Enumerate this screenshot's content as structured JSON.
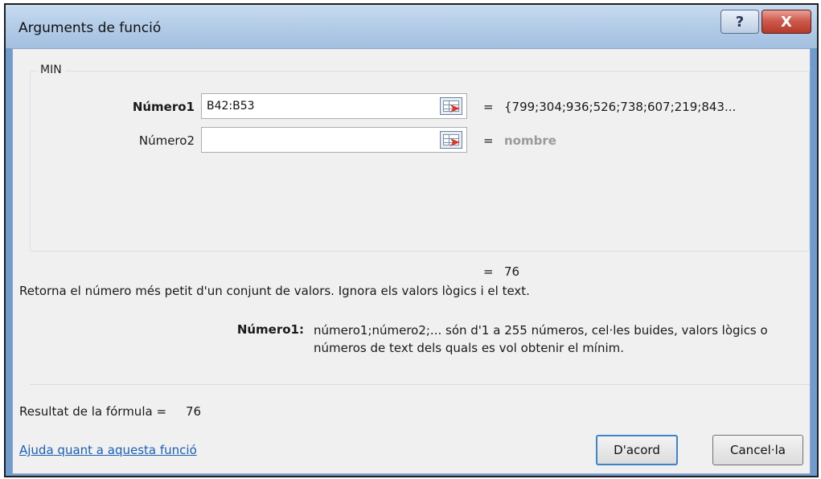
{
  "window": {
    "title": "Arguments de funció",
    "help_glyph": "?",
    "close_glyph": "X"
  },
  "group": {
    "function_name": "MIN"
  },
  "arguments": [
    {
      "label": "Número1",
      "value": "B42:B53",
      "result": "{799;304;936;526;738;607;219;843..."
    },
    {
      "label": "Número2",
      "value": "",
      "result": "nombre"
    }
  ],
  "equals_sign": "=",
  "function_result": "76",
  "description": "Retorna el número més petit d'un conjunt de valors. Ignora els valors lògics i el text.",
  "argument_help": {
    "label": "Número1:",
    "text": "número1;número2;... són d'1 a 255 números, cel·les buides, valors lògics o números de text dels quals es vol obtenir el mínim."
  },
  "formula_result": {
    "label": "Resultat de la fórmula =",
    "value": "76"
  },
  "help_link": "Ajuda quant a aquesta funció",
  "buttons": {
    "ok": "D'acord",
    "cancel": "Cancel·la"
  }
}
